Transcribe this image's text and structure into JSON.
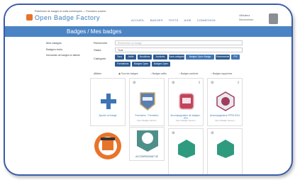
{
  "header": {
    "tagline": "Plateforme de badges et outils numériques — Formation ouverte",
    "logo": "Open Badge Factory",
    "nav": [
      "ACCUEIL",
      "BADGES",
      "TESTS",
      "AIDE",
      "CONNEXION"
    ],
    "user_line1": "Utilisateur",
    "user_line2": "Déconnexion"
  },
  "titlebar": {
    "title": "Badges / Mes badges"
  },
  "sidebar": [
    "Mes badges",
    "Badges émis",
    "Demandes de badges en attente"
  ],
  "filters": {
    "search_label": "Recherche",
    "search_placeholder": "Rechercher un badge",
    "status_label": "Statut",
    "status_value": "Tous",
    "categories_label": "Catégorie",
    "row1": [
      "Tous",
      "Actifs",
      "Brouillons",
      "Archivés",
      "Sans catégorie",
      "Badges Open Badge Factory",
      "Evénements",
      "PIX"
    ],
    "row2": [
      "Formations",
      "Badges Open CBT",
      "Badges Open PEF"
    ]
  },
  "view": {
    "label": "Afficher",
    "options": [
      "Tous les badges",
      "Badges actifs",
      "Badges archivés",
      "Badges supprimés"
    ]
  },
  "cards": [
    {
      "title": "Ajouter un badge",
      "sub": ""
    },
    {
      "title": "Formateur · Formation",
      "sub": "Open Badge Factory"
    },
    {
      "title": "Accompagnateur de badges · IPN",
      "sub": "Open Badge Factory"
    },
    {
      "title": "Accompagnateur PFPA 2021",
      "sub": "Open Badge Factory"
    }
  ],
  "badge_row2_label": "ACCOMPAGNANT IIE",
  "colors": {
    "bar": "#4a84c4",
    "chip": "#2d5b90",
    "frame": "#3b5da8"
  }
}
